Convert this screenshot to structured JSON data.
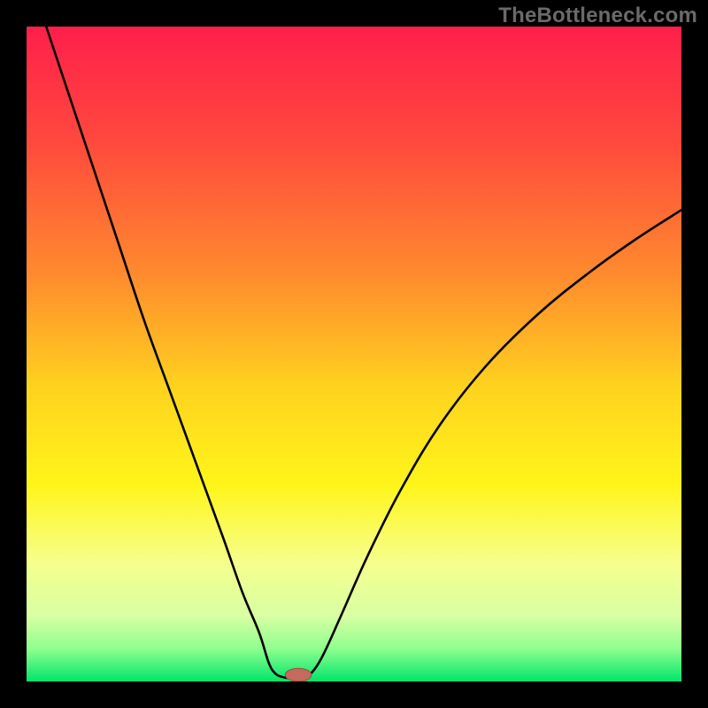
{
  "watermark": "TheBottleneck.com",
  "colors": {
    "frame_bg": "#000000",
    "watermark_text": "#6a6a6a",
    "curve": "#000000",
    "marker_fill": "#c46a5f",
    "marker_stroke": "#a04a42",
    "gradient_stops": [
      {
        "offset": 0.0,
        "color": "#ff1f4b"
      },
      {
        "offset": 0.18,
        "color": "#ff4a3d"
      },
      {
        "offset": 0.38,
        "color": "#ff8b2e"
      },
      {
        "offset": 0.55,
        "color": "#ffd21f"
      },
      {
        "offset": 0.7,
        "color": "#fff51a"
      },
      {
        "offset": 0.82,
        "color": "#f6ff8e"
      },
      {
        "offset": 0.9,
        "color": "#d8ffa3"
      },
      {
        "offset": 0.95,
        "color": "#8fff8f"
      },
      {
        "offset": 1.0,
        "color": "#00e56a"
      }
    ]
  },
  "chart_data": {
    "type": "line",
    "title": "",
    "xlabel": "",
    "ylabel": "",
    "xlim": [
      0,
      100
    ],
    "ylim": [
      0,
      100
    ],
    "x_of_min": 40,
    "left_branch": {
      "x_start": 3,
      "y_start": 100
    },
    "right_branch": {
      "x_end": 100,
      "y_end": 72
    },
    "flat_bottom": {
      "x0": 37,
      "x1": 43,
      "y": 0.5
    },
    "marker": {
      "x": 41.5,
      "y": 1.0,
      "rx": 2.0,
      "ry": 1.0
    },
    "series": [
      {
        "name": "bottleneck-curve",
        "x": [
          3,
          6,
          10,
          14,
          18,
          22,
          26,
          30,
          33,
          35.5,
          37,
          38,
          39,
          40,
          41,
          42,
          43,
          45,
          48,
          52,
          57,
          63,
          70,
          78,
          86,
          93,
          100
        ],
        "y": [
          100,
          91,
          79,
          67,
          55,
          44,
          33,
          22,
          13.5,
          7.5,
          2.8,
          1.2,
          0.7,
          0.5,
          0.5,
          0.6,
          0.8,
          3.5,
          10,
          19,
          29,
          39,
          48,
          56,
          62.5,
          67.5,
          72
        ]
      }
    ]
  }
}
